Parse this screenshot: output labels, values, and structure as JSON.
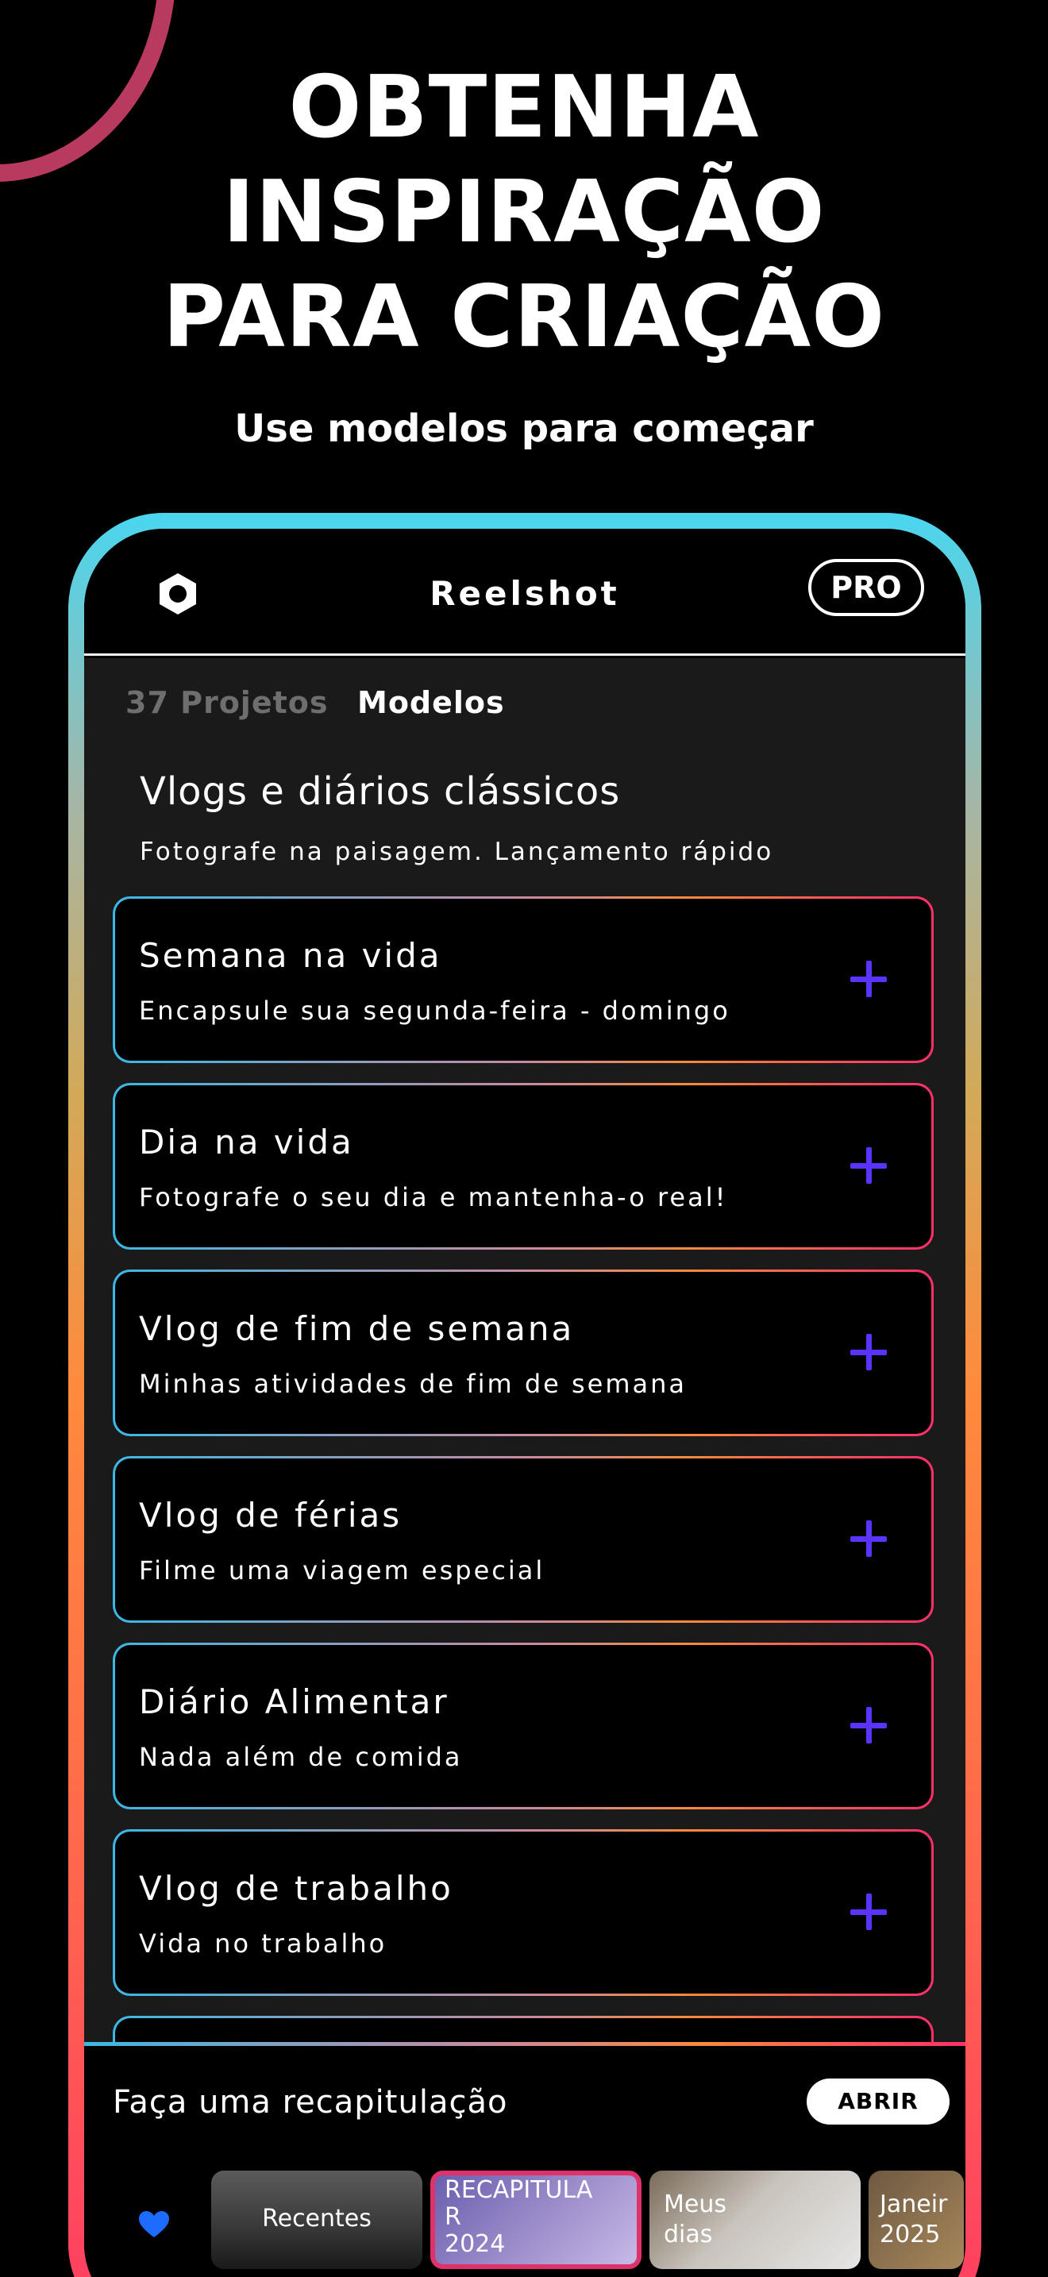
{
  "hero": {
    "title": "OBTENHA\nINSPIRAÇÃO\nPARA CRIAÇÃO",
    "subtitle": "Use modelos para começar"
  },
  "app": {
    "title": "Reelshot",
    "pro_label": "PRO",
    "logo_icon": "hexagon-logo-icon"
  },
  "tabs": [
    {
      "label": "37 Projetos"
    },
    {
      "label": "Modelos"
    }
  ],
  "section": {
    "title": "Vlogs e diários clássicos",
    "description": "Fotografe na paisagem. Lançamento rápido"
  },
  "templates": [
    {
      "title": "Semana na vida",
      "description": "Encapsule sua segunda-feira - domingo"
    },
    {
      "title": "Dia na vida",
      "description": "Fotografe o seu dia e mantenha-o real!"
    },
    {
      "title": "Vlog de fim de semana",
      "description": "Minhas atividades de fim de semana"
    },
    {
      "title": "Vlog de férias",
      "description": "Filme uma viagem especial"
    },
    {
      "title": "Diário Alimentar",
      "description": "Nada além de comida"
    },
    {
      "title": "Vlog de trabalho",
      "description": "Vida no trabalho"
    }
  ],
  "recap": {
    "title": "Faça uma recapitulação",
    "open_label": "ABRIR",
    "favorite_icon": "heart-icon",
    "albums": [
      {
        "label": "Recentes"
      },
      {
        "label": "RECAPITULA\nR\n2024"
      },
      {
        "label": "Meus\ndias"
      },
      {
        "label": "Janeir\n2025"
      }
    ]
  },
  "colors": {
    "accent_plus": "#5a33ff",
    "heart": "#1e6bff",
    "background": "#000000",
    "content_background": "#1a1a1a"
  }
}
